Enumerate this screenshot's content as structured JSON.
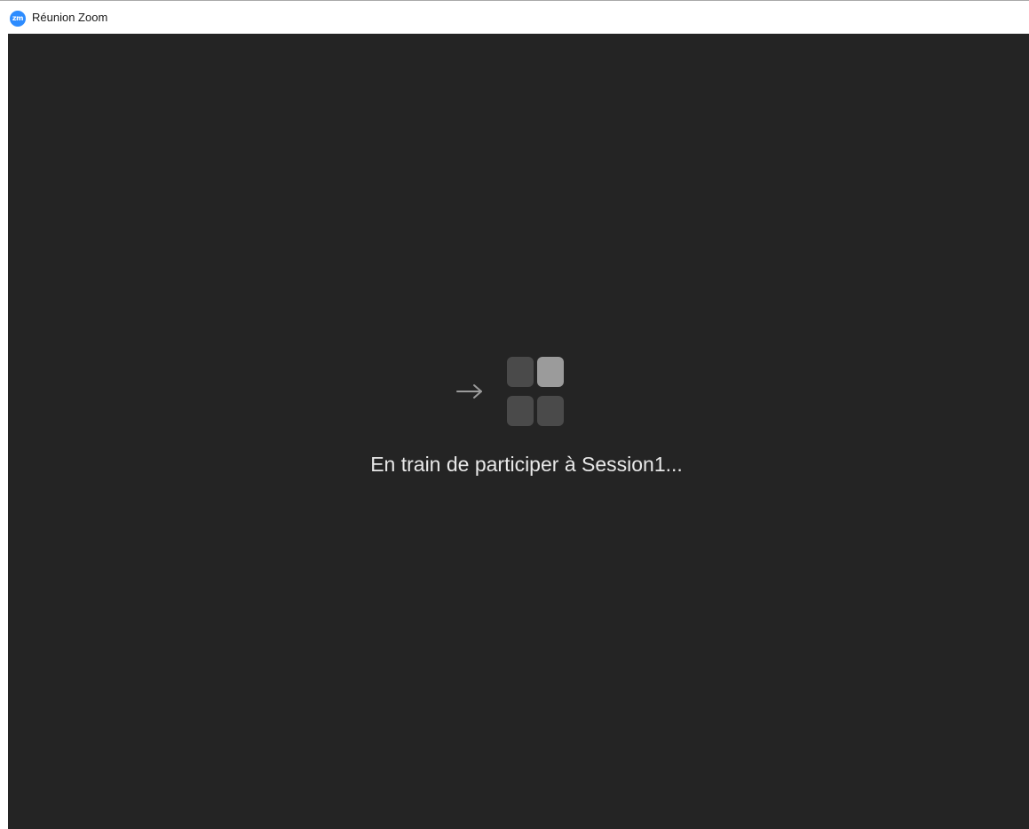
{
  "window": {
    "title": "Réunion Zoom",
    "app_logo_text": "zm"
  },
  "main": {
    "loading_icon": "meeting-join-loader",
    "status_text": "En train de participer à Session1..."
  },
  "colors": {
    "logo_blue": "#2d8cff",
    "background": "#242424",
    "tile_dim": "#4a4a4a",
    "tile_active": "#9b9b9b",
    "text": "#e8e8e8"
  }
}
